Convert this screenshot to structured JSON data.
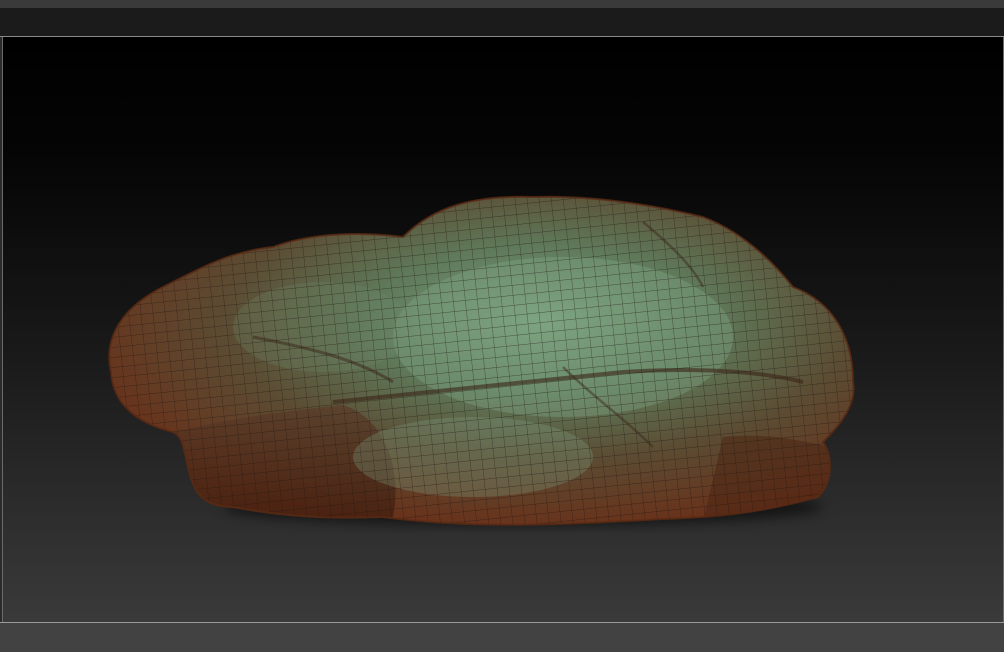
{
  "viewport": {
    "model": {
      "icon": "rock-mesh-icon",
      "colors": {
        "highlight": "#6e9274",
        "mid": "#55624a",
        "shadow": "#6a3a22",
        "wire": "#2a1a12"
      }
    }
  },
  "theme": {
    "shelf": "#1b1b1b",
    "bottom_shelf": "#424242",
    "frame": "#3a3a3a"
  }
}
